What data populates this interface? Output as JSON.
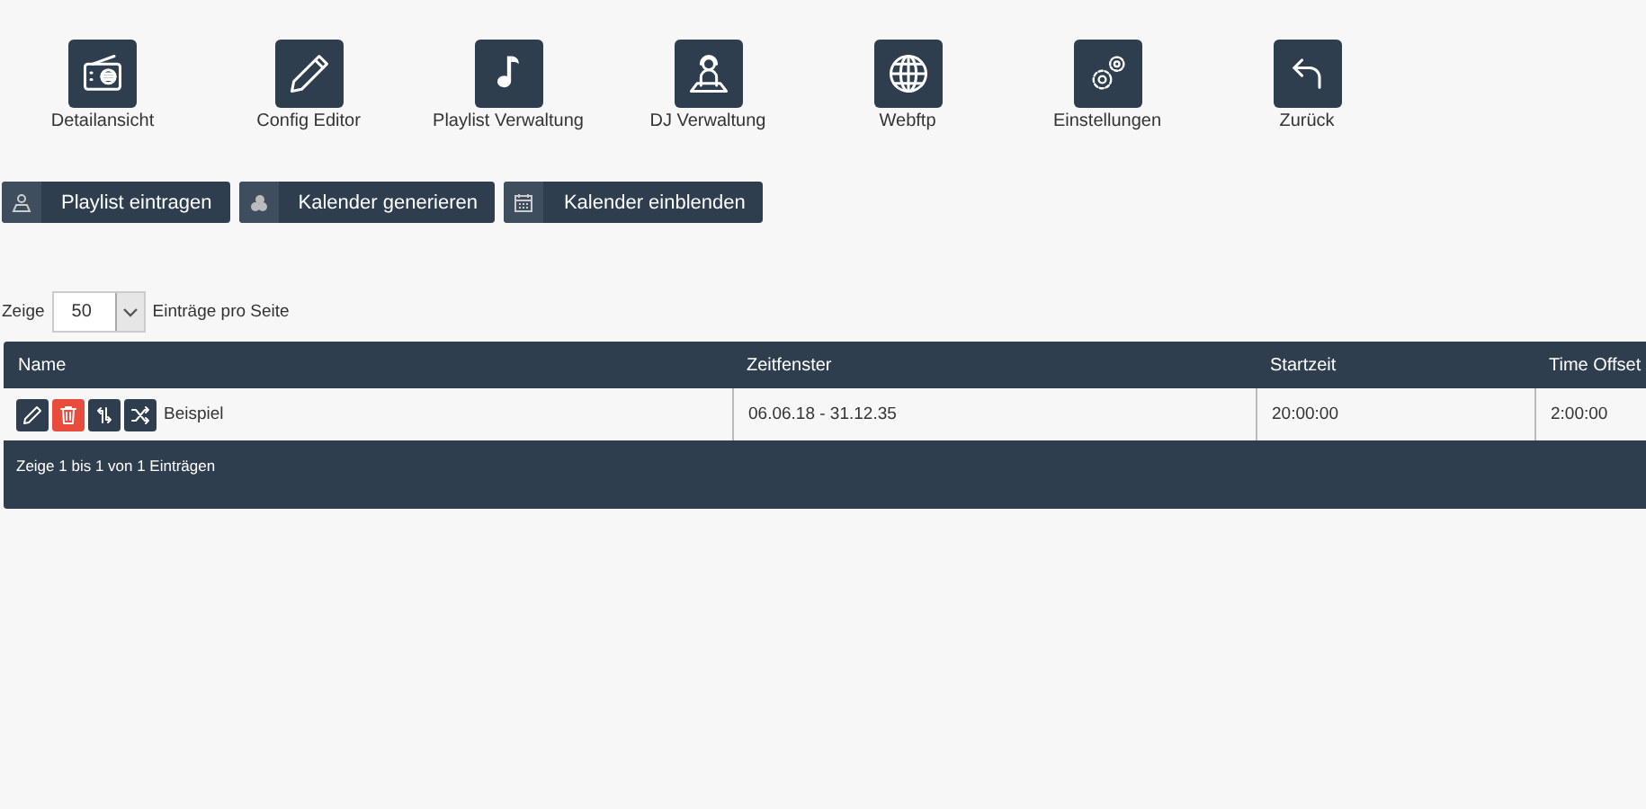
{
  "nav": [
    {
      "kind": "radio",
      "label": "Detailansicht"
    },
    {
      "kind": "pencil",
      "label": "Config Editor"
    },
    {
      "kind": "note",
      "label": "Playlist Verwaltung"
    },
    {
      "kind": "dj",
      "label": "DJ Verwaltung"
    },
    {
      "kind": "globe",
      "label": "Webftp"
    },
    {
      "kind": "gears",
      "label": "Einstellungen"
    },
    {
      "kind": "back",
      "label": "Zurück"
    }
  ],
  "actions": [
    {
      "kind": "person",
      "label": "Playlist eintragen"
    },
    {
      "kind": "cluster",
      "label": "Kalender generieren"
    },
    {
      "kind": "calendar",
      "label": "Kalender einblenden"
    }
  ],
  "page_length": {
    "prefix": "Zeige",
    "value": "50",
    "suffix": "Einträge pro Seite"
  },
  "table": {
    "columns": [
      "Name",
      "Zeitfenster",
      "Startzeit",
      "Time Offset"
    ],
    "rows": [
      {
        "actions": [
          {
            "kind": "edit"
          },
          {
            "kind": "delete"
          },
          {
            "kind": "repeat"
          },
          {
            "kind": "shuffle"
          }
        ],
        "cells": [
          "Beispiel",
          "06.06.18 - 31.12.35",
          "20:00:00",
          "2:00:00"
        ]
      }
    ],
    "info": "Zeige 1 bis 1 von 1 Einträgen"
  }
}
